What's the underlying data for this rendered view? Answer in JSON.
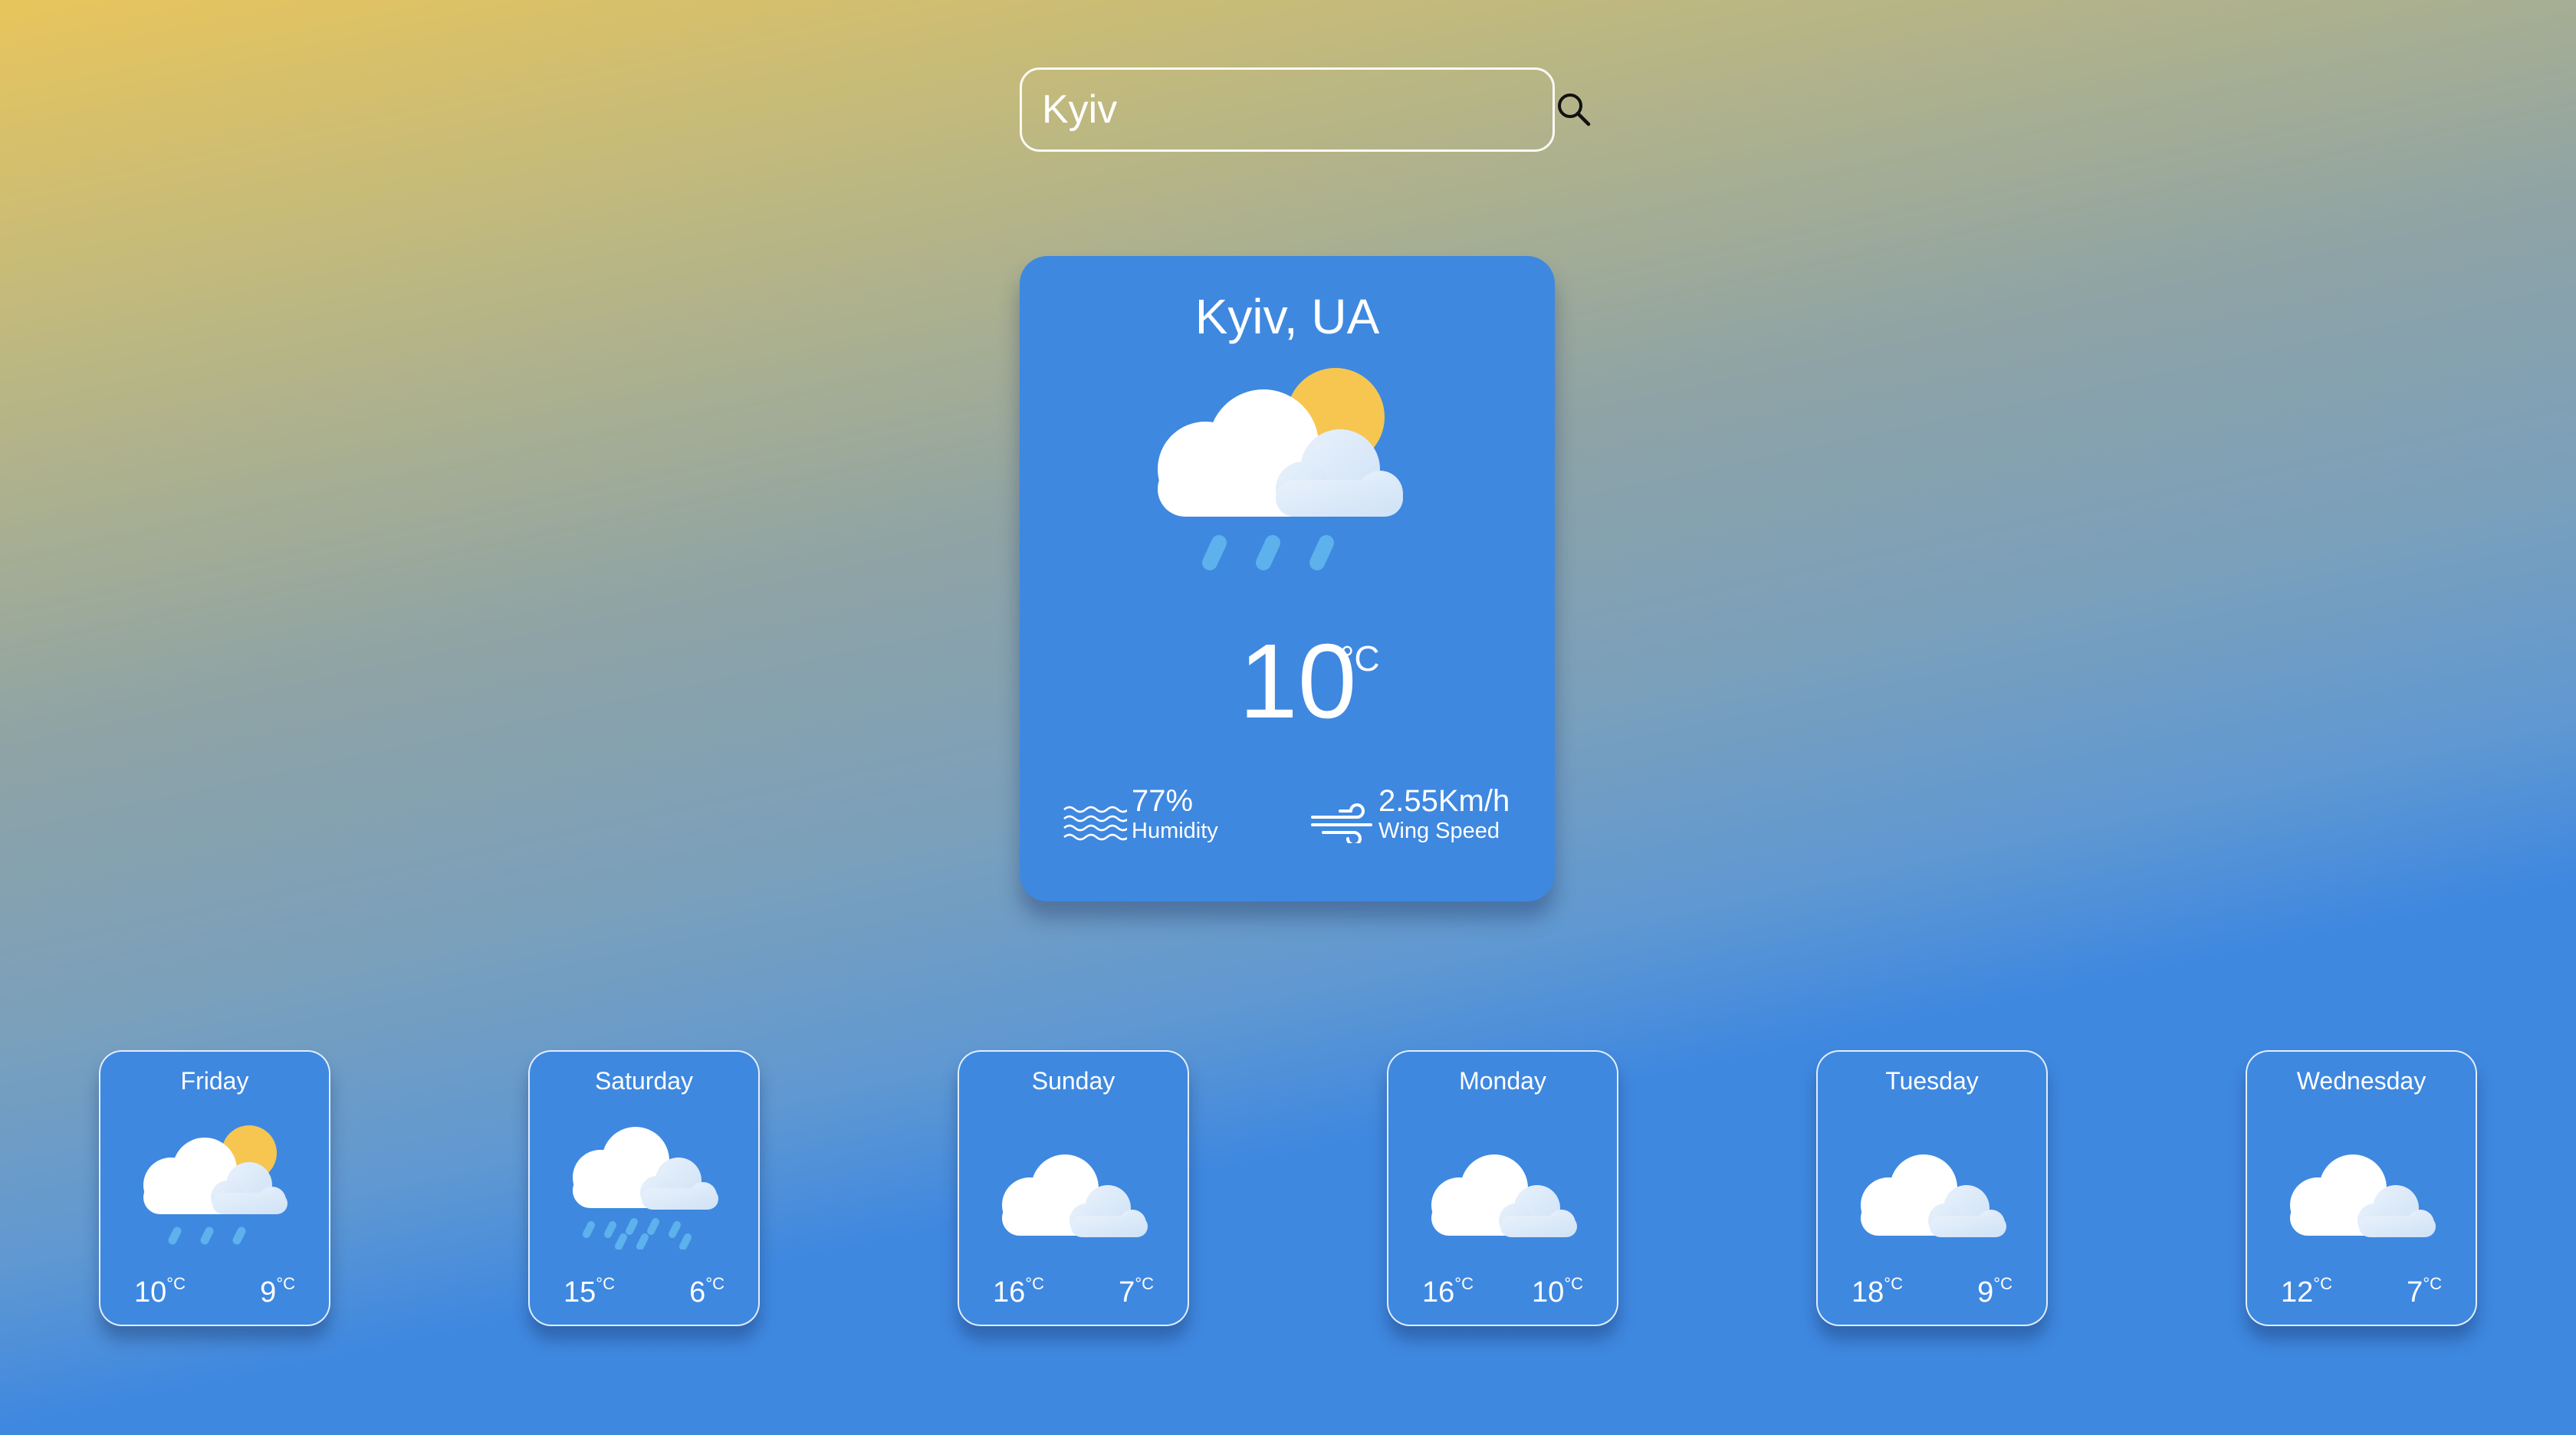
{
  "search": {
    "value": "Kyiv",
    "placeholder": "Search city"
  },
  "current": {
    "city": "Kyiv, UA",
    "temperature": "10",
    "unit": "°C",
    "icon": "cloud-sun-rain-icon",
    "humidity_value": "77%",
    "humidity_label": "Humidity",
    "wind_value": "2.55Km/h",
    "wind_label": "Wing Speed"
  },
  "forecast": [
    {
      "day": "Friday",
      "high": "10",
      "low": "9",
      "icon": "cloud-sun-rain-icon"
    },
    {
      "day": "Saturday",
      "high": "15",
      "low": "6",
      "icon": "cloud-heavy-rain-icon"
    },
    {
      "day": "Sunday",
      "high": "16",
      "low": "7",
      "icon": "cloud-icon"
    },
    {
      "day": "Monday",
      "high": "16",
      "low": "10",
      "icon": "cloud-icon"
    },
    {
      "day": "Tuesday",
      "high": "18",
      "low": "9",
      "icon": "cloud-icon"
    },
    {
      "day": "Wednesday",
      "high": "12",
      "low": "7",
      "icon": "cloud-icon"
    }
  ],
  "unit_symbol": "°C",
  "colors": {
    "card": "#3e88e0",
    "sun": "#f6c651",
    "cloud_front": "#ffffff",
    "cloud_back": "#dbe9f8",
    "rain": "#5db1ec"
  }
}
